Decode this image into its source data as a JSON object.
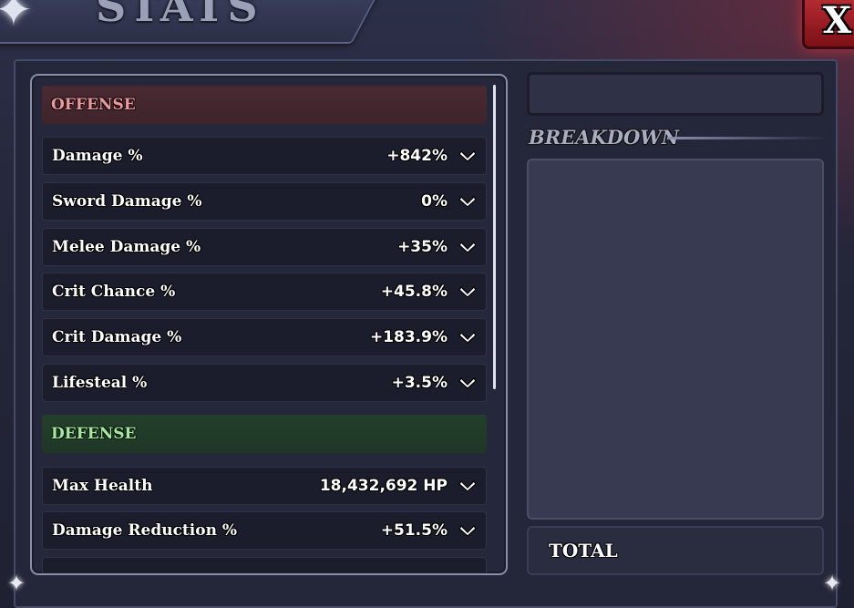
{
  "window": {
    "title": "STATS",
    "close_label": "X"
  },
  "offense": {
    "header": "OFFENSE",
    "rows": [
      {
        "label": "Damage %",
        "value": "+842%"
      },
      {
        "label": "Sword Damage %",
        "value": "0%"
      },
      {
        "label": "Melee Damage %",
        "value": "+35%"
      },
      {
        "label": "Crit Chance %",
        "value": "+45.8%"
      },
      {
        "label": "Crit Damage %",
        "value": "+183.9%"
      },
      {
        "label": "Lifesteal %",
        "value": "+3.5%"
      }
    ]
  },
  "defense": {
    "header": "DEFENSE",
    "rows": [
      {
        "label": "Max Health",
        "value": "18,432,692 HP"
      },
      {
        "label": "Damage Reduction %",
        "value": "+51.5%"
      }
    ]
  },
  "breakdown": {
    "title": "BREAKDOWN",
    "total_label": "TOTAL"
  },
  "colors": {
    "offense_accent": "#e89a9e",
    "defense_accent": "#a7e6a0",
    "close_button": "#c0303a"
  },
  "icons": {
    "row_expand": "chevron-down-icon",
    "corners": "star-icon"
  }
}
